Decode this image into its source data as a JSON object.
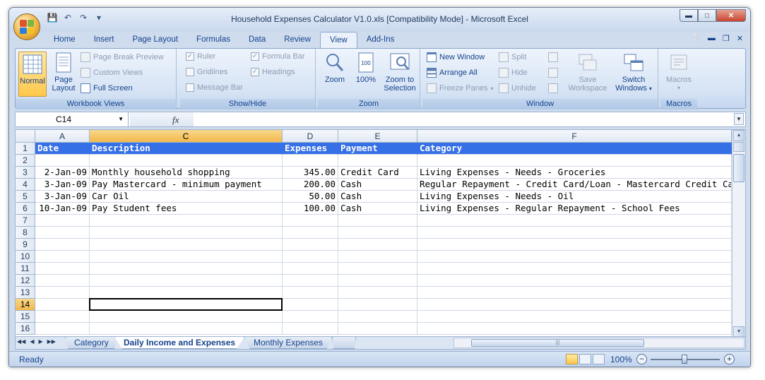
{
  "window": {
    "title": "Household Expenses Calculator V1.0.xls  [Compatibility Mode] - Microsoft Excel"
  },
  "qat": {
    "save_icon": "save-icon",
    "undo_icon": "undo-icon",
    "redo_icon": "redo-icon"
  },
  "tabs": [
    {
      "label": "Home"
    },
    {
      "label": "Insert"
    },
    {
      "label": "Page Layout"
    },
    {
      "label": "Formulas"
    },
    {
      "label": "Data"
    },
    {
      "label": "Review"
    },
    {
      "label": "View"
    },
    {
      "label": "Add-Ins"
    }
  ],
  "ribbon": {
    "workbook_views": {
      "label": "Workbook Views",
      "normal": "Normal",
      "page_layout_1": "Page",
      "page_layout_2": "Layout",
      "page_break_preview": "Page Break Preview",
      "custom_views": "Custom Views",
      "full_screen": "Full Screen"
    },
    "show_hide": {
      "label": "Show/Hide",
      "ruler": "Ruler",
      "gridlines": "Gridlines",
      "message_bar": "Message Bar",
      "formula_bar": "Formula Bar",
      "headings": "Headings"
    },
    "zoom": {
      "label": "Zoom",
      "zoom": "Zoom",
      "hundred": "100%",
      "zoom_sel_1": "Zoom to",
      "zoom_sel_2": "Selection"
    },
    "window": {
      "label": "Window",
      "new_window": "New Window",
      "arrange_all": "Arrange All",
      "freeze_panes": "Freeze Panes",
      "split": "Split",
      "hide": "Hide",
      "unhide": "Unhide",
      "save_ws_1": "Save",
      "save_ws_2": "Workspace",
      "switch_1": "Switch",
      "switch_2": "Windows"
    },
    "macros": {
      "label": "Macros",
      "macros": "Macros"
    }
  },
  "formula_bar": {
    "name_box": "C14",
    "fx": "fx",
    "content": ""
  },
  "columns": [
    {
      "id": "A",
      "active": false
    },
    {
      "id": "C",
      "active": true
    },
    {
      "id": "D",
      "active": false
    },
    {
      "id": "E",
      "active": false
    },
    {
      "id": "F",
      "active": false
    }
  ],
  "rows": [
    "1",
    "2",
    "3",
    "4",
    "5",
    "6",
    "7",
    "8",
    "9",
    "10",
    "11",
    "12",
    "13",
    "14",
    "15",
    "16"
  ],
  "active_row": "14",
  "table": {
    "headers": [
      "Date",
      "Description",
      "Expenses",
      "Payment",
      "Category"
    ],
    "data": [
      [],
      [
        "2-Jan-09",
        "Monthly household shopping",
        "345.00",
        "Credit Card",
        "Living Expenses - Needs - Groceries"
      ],
      [
        "3-Jan-09",
        "Pay Mastercard - minimum payment",
        "200.00",
        "Cash",
        "Regular Repayment - Credit Card/Loan - Mastercard Credit Card"
      ],
      [
        "3-Jan-09",
        "Car Oil",
        "50.00",
        "Cash",
        "Living Expenses - Needs - Oil"
      ],
      [
        "10-Jan-09",
        "Pay Student fees",
        "100.00",
        "Cash",
        "Living Expenses - Regular Repayment - School Fees"
      ]
    ]
  },
  "sheets": [
    {
      "label": "Category",
      "active": false
    },
    {
      "label": "Daily Income and Expenses",
      "active": true
    },
    {
      "label": "Monthly Expenses",
      "active": false
    }
  ],
  "status": {
    "ready": "Ready",
    "zoom": "100%"
  },
  "colors": {
    "header_fill": "#3670e6",
    "ribbon_text": "#15428b",
    "selection_header": "#f3b84c"
  }
}
